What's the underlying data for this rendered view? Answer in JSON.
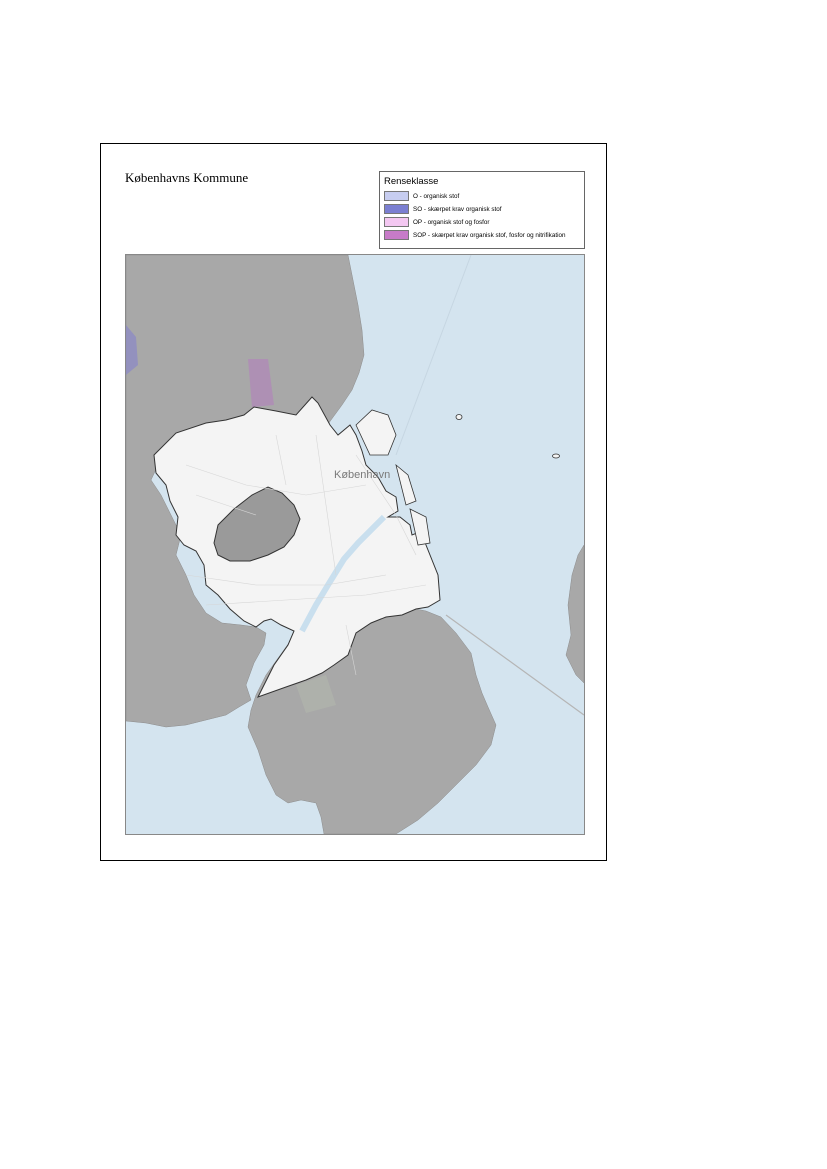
{
  "map": {
    "title": "Københavns Kommune",
    "place_label": "København",
    "legend": {
      "title": "Renseklasse",
      "items": [
        {
          "label": "O - organisk stof",
          "color": "#c7cdf0"
        },
        {
          "label": "SO - skærpet krav organisk stof",
          "color": "#7b7fd1"
        },
        {
          "label": "OP - organisk stof og fosfor",
          "color": "#f4c8f2"
        },
        {
          "label": "SOP - skærpet krav organisk stof, fosfor og nitrifikation",
          "color": "#c77bc8"
        }
      ]
    },
    "colors": {
      "sea": "#d4e4ef",
      "land": "#a8a8a8",
      "municipality": "#f4f4f4",
      "enclave": "#9a9a9a"
    }
  }
}
